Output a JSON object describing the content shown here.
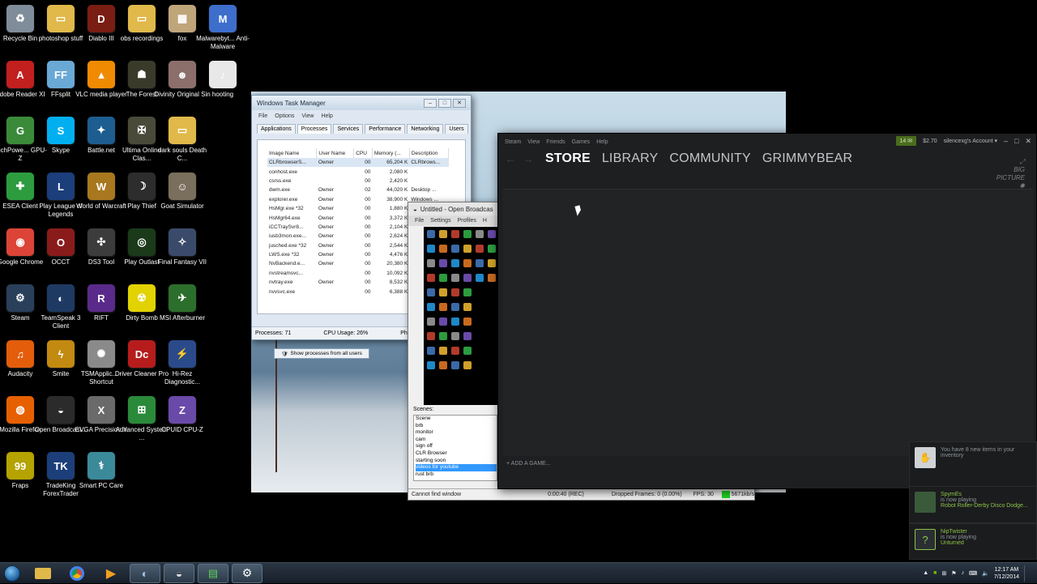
{
  "desktop": {
    "icons": [
      {
        "label": "Recycle Bin",
        "icon": "recycle-bin-icon",
        "color": "#7f8c99",
        "glyph": "♻"
      },
      {
        "label": "photoshop stuff",
        "icon": "folder-icon",
        "color": "#e0b94a",
        "glyph": "▭"
      },
      {
        "label": "Diablo III",
        "icon": "diablo-icon",
        "color": "#7a1d12",
        "glyph": "D"
      },
      {
        "label": "obs recordings",
        "icon": "folder-icon",
        "color": "#e0b94a",
        "glyph": "▭"
      },
      {
        "label": "fox",
        "icon": "image-icon",
        "color": "#bfa57a",
        "glyph": "▦"
      },
      {
        "label": "Malwarebyt... Anti-Malware",
        "icon": "malwarebytes-icon",
        "color": "#3d6ecb",
        "glyph": "M"
      },
      {
        "label": "Adobe Reader XI",
        "icon": "adobe-reader-icon",
        "color": "#c21f1f",
        "glyph": "A"
      },
      {
        "label": "FFsplit",
        "icon": "ffsplit-icon",
        "color": "#6aa9d6",
        "glyph": "FF"
      },
      {
        "label": "VLC media player",
        "icon": "vlc-icon",
        "color": "#f08a00",
        "glyph": "▲"
      },
      {
        "label": "The Forest",
        "icon": "the-forest-icon",
        "color": "#3a3a2a",
        "glyph": "☗"
      },
      {
        "label": "Divinity Original Sin",
        "icon": "divinity-icon",
        "color": "#8c6f6a",
        "glyph": "☻"
      },
      {
        "label": "hooting",
        "icon": "wav-file-icon",
        "color": "#e8e8e8",
        "glyph": "♪"
      },
      {
        "label": "TechPowe... GPU-Z",
        "icon": "gpu-z-icon",
        "color": "#3a8a3a",
        "glyph": "G"
      },
      {
        "label": "Skype",
        "icon": "skype-icon",
        "color": "#00aff0",
        "glyph": "S"
      },
      {
        "label": "Battle.net",
        "icon": "battlenet-icon",
        "color": "#1d5d8f",
        "glyph": "✦"
      },
      {
        "label": "Ultima Online Clas...",
        "icon": "ultima-icon",
        "color": "#4a4a3a",
        "glyph": "✠"
      },
      {
        "label": "dark souls Death C...",
        "icon": "folder-icon",
        "color": "#e0b94a",
        "glyph": "▭"
      },
      {
        "label": "ESEA Client",
        "icon": "esea-icon",
        "color": "#2c9c3f",
        "glyph": "✚"
      },
      {
        "label": "Play League of Legends",
        "icon": "league-icon",
        "color": "#1c3e7a",
        "glyph": "L"
      },
      {
        "label": "World of Warcraft",
        "icon": "wow-icon",
        "color": "#a8781f",
        "glyph": "W"
      },
      {
        "label": "Play Thief",
        "icon": "thief-icon",
        "color": "#2d2d2d",
        "glyph": "☽"
      },
      {
        "label": "Goat Simulator",
        "icon": "goat-simulator-icon",
        "color": "#7a6e5c",
        "glyph": "☺"
      },
      {
        "label": "Google Chrome",
        "icon": "chrome-icon",
        "color": "#db4437",
        "glyph": "◉"
      },
      {
        "label": "OCCT",
        "icon": "occt-icon",
        "color": "#8a1b1b",
        "glyph": "O"
      },
      {
        "label": "DS3 Tool",
        "icon": "gamepad-icon",
        "color": "#3c3c3c",
        "glyph": "✣"
      },
      {
        "label": "Play Outlast",
        "icon": "outlast-icon",
        "color": "#1a3a1a",
        "glyph": "◎"
      },
      {
        "label": "Final Fantasy VII",
        "icon": "final-fantasy-icon",
        "color": "#3a4a6a",
        "glyph": "✧"
      },
      {
        "label": "Steam",
        "icon": "steam-icon",
        "color": "#2a3f5a",
        "glyph": "⚙"
      },
      {
        "label": "TeamSpeak 3 Client",
        "icon": "teamspeak-icon",
        "color": "#1e3a63",
        "glyph": "◐"
      },
      {
        "label": "RIFT",
        "icon": "rift-icon",
        "color": "#5a2a8a",
        "glyph": "R"
      },
      {
        "label": "Dirty Bomb",
        "icon": "dirty-bomb-icon",
        "color": "#e2d200",
        "glyph": "☢"
      },
      {
        "label": "MSI Afterburner",
        "icon": "msi-afterburner-icon",
        "color": "#2c6e2c",
        "glyph": "✈"
      },
      {
        "label": "Audacity",
        "icon": "audacity-icon",
        "color": "#e35d0b",
        "glyph": "♫"
      },
      {
        "label": "Smite",
        "icon": "smite-icon",
        "color": "#c28a10",
        "glyph": "ϟ"
      },
      {
        "label": "TSMApplic... - Shortcut",
        "icon": "tsm-icon",
        "color": "#8a8a8a",
        "glyph": "✺"
      },
      {
        "label": "Driver Cleaner Pro",
        "icon": "driver-cleaner-icon",
        "color": "#b61c1c",
        "glyph": "Dc"
      },
      {
        "label": "Hi-Rez Diagnostic...",
        "icon": "hirez-icon",
        "color": "#2a4a8a",
        "glyph": "⚡"
      },
      {
        "label": "Mozilla Firefox",
        "icon": "firefox-icon",
        "color": "#e76000",
        "glyph": "◍"
      },
      {
        "label": "Open Broadcast...",
        "icon": "obs-icon",
        "color": "#2b2b2b",
        "glyph": "◒"
      },
      {
        "label": "EVGA Precision X",
        "icon": "evga-icon",
        "color": "#6a6a6a",
        "glyph": "X"
      },
      {
        "label": "Advanced System ...",
        "icon": "advanced-system-care-icon",
        "color": "#2a8a3a",
        "glyph": "⊞"
      },
      {
        "label": "CPUID CPU-Z",
        "icon": "cpu-z-icon",
        "color": "#6a4aa8",
        "glyph": "Z"
      },
      {
        "label": "Fraps",
        "icon": "fraps-icon",
        "color": "#b5a300",
        "glyph": "99"
      },
      {
        "label": "TradeKing ForexTrader",
        "icon": "tradeking-icon",
        "color": "#1c3f7a",
        "glyph": "TK"
      },
      {
        "label": "Smart PC Care",
        "icon": "smart-pc-care-icon",
        "color": "#3a8a9a",
        "glyph": "⚕"
      }
    ]
  },
  "taskmgr": {
    "title": "Windows Task Manager",
    "menu": [
      "File",
      "Options",
      "View",
      "Help"
    ],
    "tabs": [
      "Applications",
      "Processes",
      "Services",
      "Performance",
      "Networking",
      "Users"
    ],
    "active_tab": "Processes",
    "columns": [
      "Image Name",
      "User Name",
      "CPU",
      "Memory (...",
      "Description"
    ],
    "rows": [
      [
        "CLRbrowserS...",
        "Owner",
        "00",
        "65,204 K",
        "CLRbrows..."
      ],
      [
        "conhost.exe",
        "",
        "00",
        "2,080 K",
        ""
      ],
      [
        "csrss.exe",
        "",
        "00",
        "2,420 K",
        ""
      ],
      [
        "dwm.exe",
        "Owner",
        "02",
        "44,020 K",
        "Desktop ..."
      ],
      [
        "explorer.exe",
        "Owner",
        "00",
        "38,900 K",
        "Windows ..."
      ],
      [
        "HsMgr.exe *32",
        "Owner",
        "00",
        "1,880 K",
        ""
      ],
      [
        "HsMgr64.exe",
        "Owner",
        "00",
        "3,372 K",
        ""
      ],
      [
        "iCCTraySvr8...",
        "Owner",
        "00",
        "2,104 K",
        ""
      ],
      [
        "iusb3mon.exe...",
        "Owner",
        "00",
        "2,624 K",
        ""
      ],
      [
        "jusched.exe *32",
        "Owner",
        "00",
        "2,544 K",
        ""
      ],
      [
        "LWS.exe *32",
        "Owner",
        "00",
        "4,476 K",
        ""
      ],
      [
        "NvBackend.e...",
        "Owner",
        "00",
        "20,380 K",
        ""
      ],
      [
        "nvstreamsvc...",
        "",
        "00",
        "10,092 K",
        ""
      ],
      [
        "nvtray.exe",
        "Owner",
        "00",
        "8,532 K",
        ""
      ],
      [
        "nvvsvc.exe",
        "",
        "00",
        "6,388 K",
        ""
      ]
    ],
    "show_all_button": "Show processes from all users",
    "status": {
      "processes": "Processes: 71",
      "cpu": "CPU Usage: 26%",
      "physical": "Physical"
    }
  },
  "obs": {
    "title": "Untitled - Open Broadcas",
    "menu": [
      "File",
      "Settings",
      "Profiles",
      "H"
    ],
    "scenes_label": "Scenes:",
    "scenes": [
      "Scene",
      "brb",
      "monitor",
      "cam",
      "sign off",
      "CLR Browser",
      "starting soon",
      "videos for youtube",
      "rust brb"
    ],
    "selected_scene": "videos for youtube",
    "status": {
      "message": "Cannot find window",
      "time": "0:00:40 (REC)",
      "dropped": "Dropped Frames: 0 (0.00%)",
      "fps": "FPS: 30",
      "bitrate": "5671kb/s"
    }
  },
  "steam": {
    "menu": [
      "Steam",
      "View",
      "Friends",
      "Games",
      "Help"
    ],
    "notifications_count": "14",
    "wallet": "$2.70",
    "account": "silencexg's Account",
    "nav": [
      "STORE",
      "LIBRARY",
      "COMMUNITY",
      "GRIMMYBEAR"
    ],
    "active_nav": "STORE",
    "big_picture": "BIG PICTURE",
    "add_game": "+  ADD A GAME..."
  },
  "toasts": [
    {
      "title": "",
      "line1": "You have 8 new items in your inventory",
      "line2": "",
      "icon": "inventory-icon"
    },
    {
      "title": "SpymEs",
      "line1": "is now playing",
      "line2": "Robot Roller-Derby Disco Dodge...",
      "icon": "avatar"
    },
    {
      "title": "NipTwister",
      "line1": "is now playing",
      "line2": "Unturned",
      "icon": "unknown-avatar-icon"
    }
  ],
  "taskbar": {
    "pinned": [
      "explorer-icon",
      "chrome-icon",
      "windows-media-icon",
      "teamspeak-icon",
      "obs-icon",
      "gpu-z-icon",
      "steam-icon"
    ],
    "time": "12:17 AM",
    "date": "7/12/2014"
  },
  "colors": {
    "steam_bg": "#1e1f20",
    "accent_green": "#8bc34a",
    "obs_select": "#3399ff"
  }
}
